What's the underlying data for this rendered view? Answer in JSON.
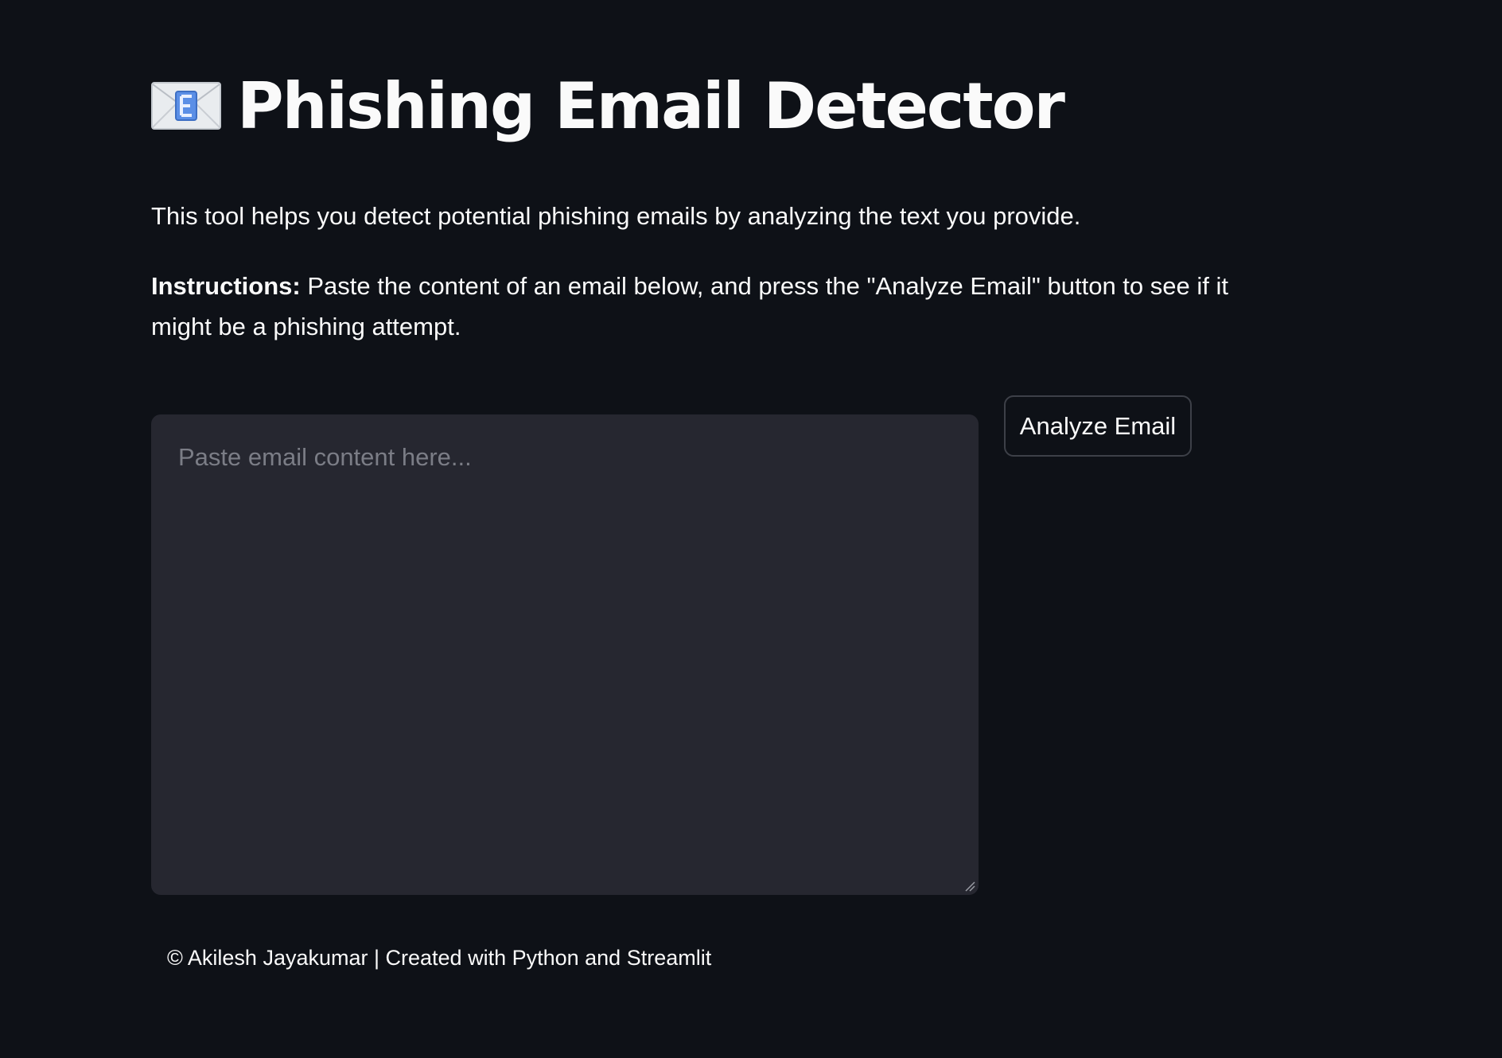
{
  "header": {
    "icon": "envelope-e-icon",
    "title": "Phishing Email Detector"
  },
  "intro": {
    "text": "This tool helps you detect potential phishing emails by analyzing the text you provide."
  },
  "instructions": {
    "label": "Instructions:",
    "text": " Paste the content of an email below, and press the \"Analyze Email\" button to see if it might be a phishing attempt."
  },
  "email_input": {
    "value": "",
    "placeholder": "Paste email content here..."
  },
  "analyze_button": {
    "label": "Analyze Email"
  },
  "footer": {
    "text": "© Akilesh Jayakumar | Created with Python and Streamlit"
  },
  "colors": {
    "background": "#0e1117",
    "input_background": "#262730",
    "text": "#fafafa",
    "placeholder": "#7b7d86",
    "button_border": "#3d4048",
    "icon_accent": "#5b8fe6"
  }
}
